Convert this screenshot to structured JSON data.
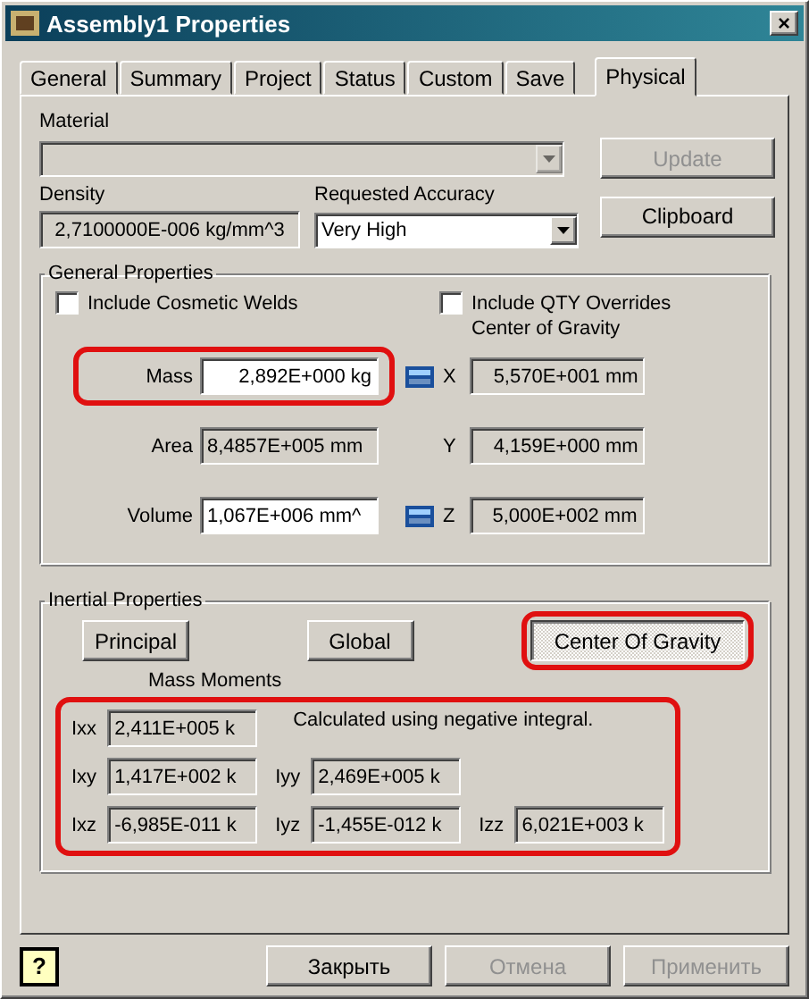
{
  "window": {
    "title": "Assembly1 Properties",
    "close": "×"
  },
  "tabs": [
    {
      "label": "General",
      "selected": false
    },
    {
      "label": "Summary",
      "selected": false
    },
    {
      "label": "Project",
      "selected": false
    },
    {
      "label": "Status",
      "selected": false
    },
    {
      "label": "Custom",
      "selected": false
    },
    {
      "label": "Save",
      "selected": false
    },
    {
      "label": "Physical",
      "selected": true
    }
  ],
  "material": {
    "label": "Material",
    "disabled": true
  },
  "side_buttons": [
    {
      "label": "Update",
      "disabled": true
    },
    {
      "label": "Clipboard",
      "disabled": false
    }
  ],
  "density": {
    "label": "Density",
    "value": "2,7100000E-006 kg/mm^3"
  },
  "accuracy": {
    "label": "Requested Accuracy",
    "value": "Very High"
  },
  "general_properties": {
    "title": "General Properties",
    "checkboxes": [
      {
        "label": "Include Cosmetic Welds",
        "checked": false
      },
      {
        "label": "Include QTY Overrides",
        "checked": false
      }
    ],
    "fields": [
      {
        "label": "Mass",
        "value": "2,892E+000 kg",
        "editable": true,
        "calculator": true,
        "highlighted": true
      },
      {
        "label": "Area",
        "value": "8,4857E+005 mm",
        "editable": false,
        "calculator": false,
        "highlighted": false
      },
      {
        "label": "Volume",
        "value": "1,067E+006 mm^",
        "editable": true,
        "calculator": true,
        "highlighted": false
      }
    ],
    "center_of_gravity": {
      "title": "Center of Gravity",
      "axes": [
        {
          "label": "X",
          "value": "5,570E+001 mm"
        },
        {
          "label": "Y",
          "value": "4,159E+000 mm"
        },
        {
          "label": "Z",
          "value": "5,000E+002 mm"
        }
      ]
    }
  },
  "inertial_properties": {
    "title": "Inertial Properties",
    "buttons": [
      {
        "label": "Principal",
        "selected": false,
        "highlighted": false
      },
      {
        "label": "Global",
        "selected": false,
        "highlighted": false
      },
      {
        "label": "Center Of Gravity",
        "selected": true,
        "highlighted": true
      }
    ],
    "mass_moments_title": "Mass Moments",
    "highlighted": true,
    "note": "Calculated using negative integral.",
    "rows": [
      [
        {
          "label": "Ixx",
          "value": "2,411E+005 k"
        }
      ],
      [
        {
          "label": "Ixy",
          "value": "1,417E+002 k"
        },
        {
          "label": "Iyy",
          "value": "2,469E+005 k"
        }
      ],
      [
        {
          "label": "Ixz",
          "value": "-6,985E-011 k"
        },
        {
          "label": "Iyz",
          "value": "-1,455E-012 k"
        },
        {
          "label": "Izz",
          "value": "6,021E+003 k"
        }
      ]
    ]
  },
  "help": "?",
  "footer_buttons": [
    {
      "label": "Закрыть",
      "disabled": false
    },
    {
      "label": "Отмена",
      "disabled": true
    },
    {
      "label": "Применить",
      "disabled": true
    }
  ]
}
